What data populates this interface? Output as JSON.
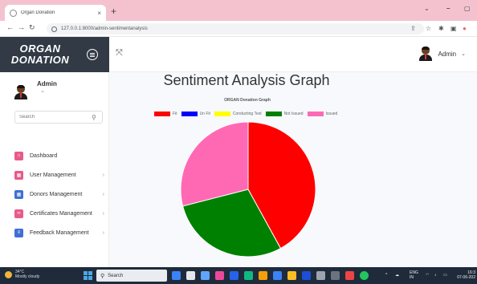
{
  "browser": {
    "tab_title": "Organ Donation",
    "tab_close": "×",
    "new_tab": "+",
    "minimize": "⌄",
    "url": "127.0.0.1:8000/admin-sentimentanalysis"
  },
  "brand": {
    "line1": "ORGAN",
    "line2": "DONATION"
  },
  "header": {
    "user_name": "Admin",
    "user_chevron": "⌄",
    "expand_glyph": "⤧"
  },
  "sidebar": {
    "user_name": "Admin",
    "user_chevron": "⌄",
    "search_placeholder": "Search",
    "items": [
      {
        "label": "Dashboard",
        "icon": "home-icon",
        "color": "#e85a8a"
      },
      {
        "label": "User Management",
        "icon": "grid-icon",
        "color": "#e85a8a"
      },
      {
        "label": "Donors Management",
        "icon": "grid-icon",
        "color": "#3f6fd6"
      },
      {
        "label": "Certificates Management",
        "icon": "link-icon",
        "color": "#e85a8a"
      },
      {
        "label": "Feedback Management",
        "icon": "feedback-icon",
        "color": "#3f6fd6"
      }
    ]
  },
  "main": {
    "title": "Sentiment Analysis Graph"
  },
  "chart_data": {
    "type": "pie",
    "title": "ORGAN Donation Graph",
    "legend_position": "top",
    "categories": [
      "Fit",
      "Un Fit",
      "Conducting Test",
      "Not Issued",
      "Issued"
    ],
    "colors": [
      "#ff0000",
      "#0000ff",
      "#ffff00",
      "#008000",
      "#ff69b4"
    ],
    "values": [
      42,
      0,
      0,
      29,
      29
    ]
  },
  "taskbar": {
    "weather_temp": "34°C",
    "weather_desc": "Mostly cloudy",
    "search_placeholder": "Search",
    "lang_line1": "ENG",
    "lang_line2": "IN",
    "time": "16:3",
    "date": "07-06-202"
  }
}
